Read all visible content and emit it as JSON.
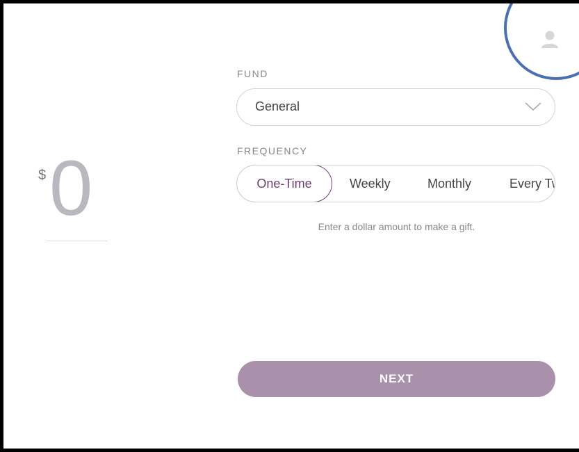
{
  "amount": {
    "currency_symbol": "$",
    "value": "0"
  },
  "fund": {
    "label": "FUND",
    "selected": "General"
  },
  "frequency": {
    "label": "FREQUENCY",
    "options": [
      {
        "label": "One-Time",
        "selected": true
      },
      {
        "label": "Weekly",
        "selected": false
      },
      {
        "label": "Monthly",
        "selected": false
      },
      {
        "label": "Every Tw",
        "selected": false
      }
    ]
  },
  "hint": "Enter a dollar amount to make a gift.",
  "actions": {
    "next_label": "NEXT"
  },
  "icons": {
    "user": "user-icon",
    "chevron": "chevron-down-icon"
  },
  "colors": {
    "accent": "#6b3f6e",
    "button": "#a991ab",
    "annotation_circle": "#4a6fb5",
    "amount_text": "#b8b8be"
  }
}
